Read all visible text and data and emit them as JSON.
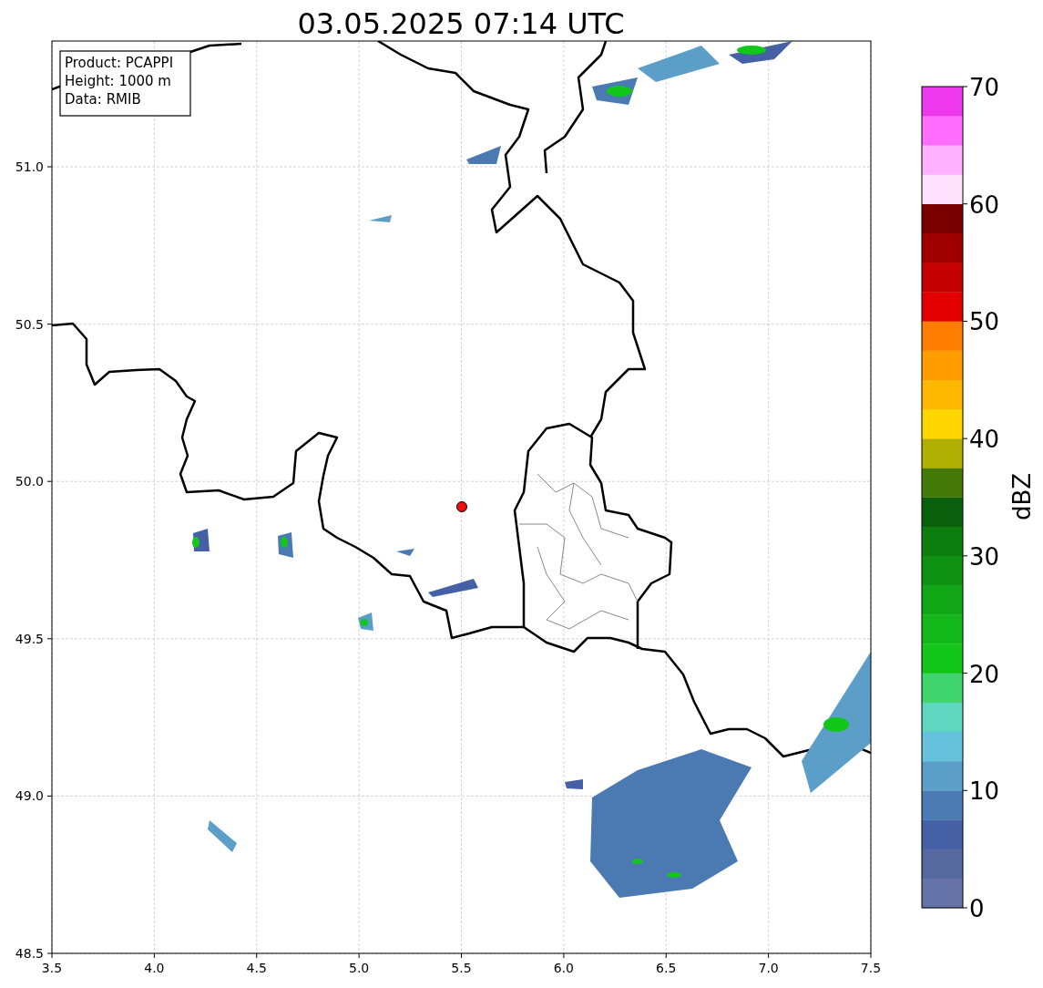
{
  "title": "03.05.2025 07:14 UTC",
  "info_box": [
    "Product: PCAPPI",
    "Height: 1000 m",
    "Data: RMIB"
  ],
  "x_axis": {
    "ticks": [
      "3.5",
      "4.0",
      "4.5",
      "5.0",
      "5.5",
      "6.0",
      "6.5",
      "7.0",
      "7.5"
    ]
  },
  "y_axis": {
    "ticks": [
      "51.0",
      "50.5",
      "50.0",
      "49.5",
      "49.0",
      "48.5"
    ]
  },
  "colorbar": {
    "label": "dBZ",
    "ticks": [
      "70",
      "60",
      "50",
      "40",
      "30",
      "20",
      "10",
      "0"
    ],
    "bands": [
      {
        "color": "#6673a8"
      },
      {
        "color": "#5568a0"
      },
      {
        "color": "#4560a5"
      },
      {
        "color": "#4b7ab3"
      },
      {
        "color": "#5b9ec8"
      },
      {
        "color": "#66c1dc"
      },
      {
        "color": "#5fd6c0"
      },
      {
        "color": "#3fd46e"
      },
      {
        "color": "#13c61a"
      },
      {
        "color": "#12b81a"
      },
      {
        "color": "#10a615"
      },
      {
        "color": "#0f9212"
      },
      {
        "color": "#0c7e10"
      },
      {
        "color": "#0a5f0c"
      },
      {
        "color": "#467a08"
      },
      {
        "color": "#afb003"
      },
      {
        "color": "#ffd600"
      },
      {
        "color": "#ffb800"
      },
      {
        "color": "#ff9c00"
      },
      {
        "color": "#ff7d00"
      },
      {
        "color": "#e40000"
      },
      {
        "color": "#c40000"
      },
      {
        "color": "#a00000"
      },
      {
        "color": "#7a0000"
      },
      {
        "color": "#ffe0fd"
      },
      {
        "color": "#ffb0fe"
      },
      {
        "color": "#ff6cff"
      },
      {
        "color": "#ee38ee"
      }
    ]
  }
}
